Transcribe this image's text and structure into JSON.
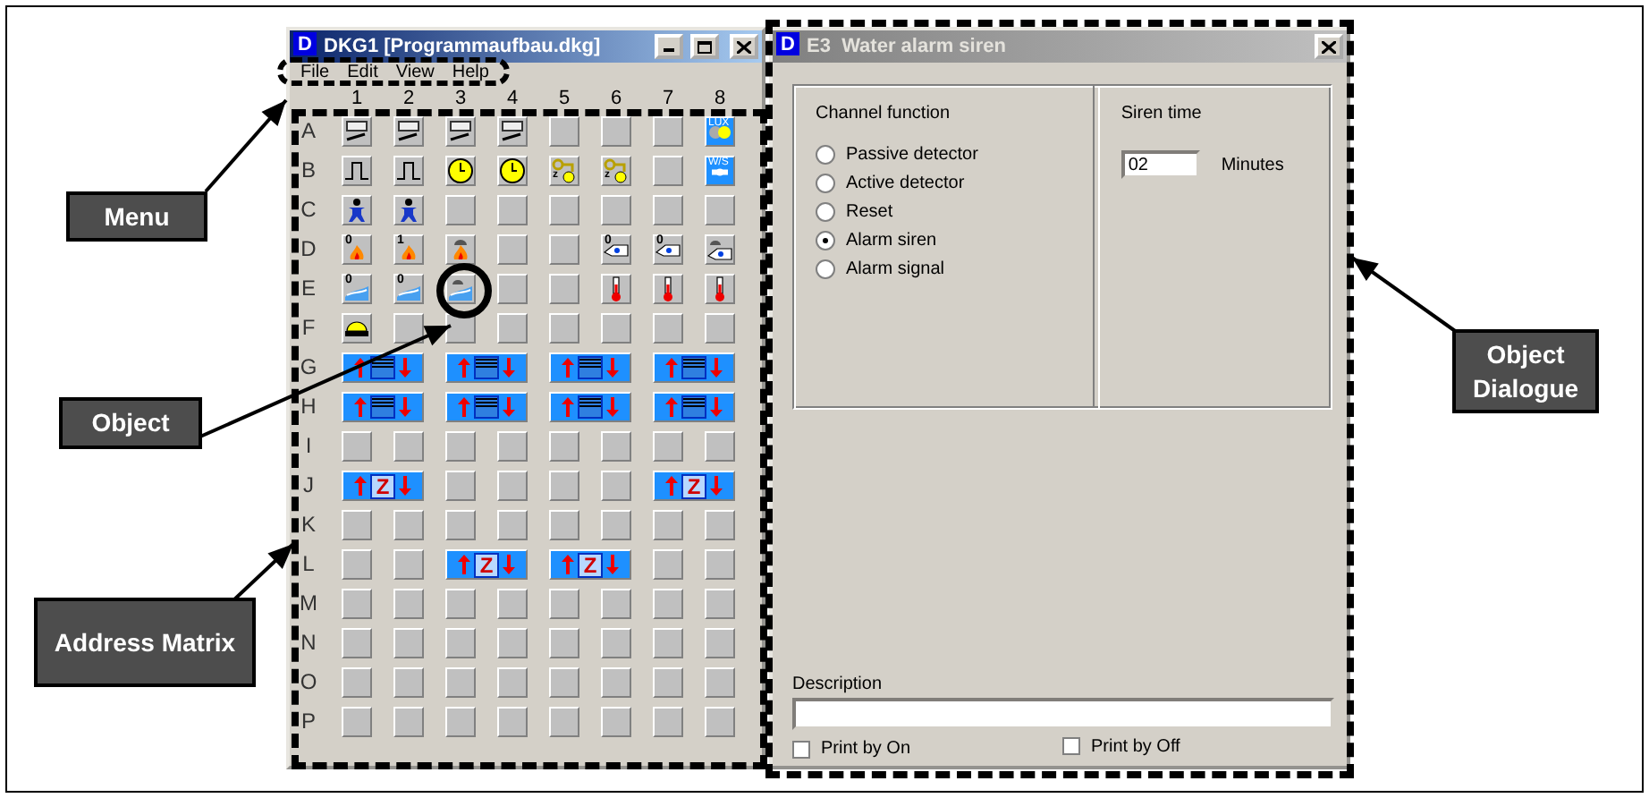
{
  "matrix_window": {
    "icon": "D",
    "title": "DKG1 [Programmaufbau.dkg]",
    "active": true,
    "menu": [
      "File",
      "Edit",
      "View",
      "Help"
    ],
    "columns": [
      "1",
      "2",
      "3",
      "4",
      "5",
      "6",
      "7",
      "8"
    ],
    "rows": [
      {
        "label": "A",
        "cells": [
          {
            "kind": "switch",
            "circled": false
          },
          {
            "kind": "switch",
            "circled": false
          },
          {
            "kind": "switch",
            "circled": false
          },
          {
            "kind": "switch",
            "circled": false
          },
          {
            "kind": "empty",
            "circled": false
          },
          {
            "kind": "empty",
            "circled": false
          },
          {
            "kind": "empty",
            "circled": false
          },
          {
            "kind": "lux",
            "label": "LUX",
            "circled": false
          }
        ]
      },
      {
        "label": "B",
        "cells": [
          {
            "kind": "pulse",
            "circled": false
          },
          {
            "kind": "pulse",
            "circled": false
          },
          {
            "kind": "clock",
            "circled": false
          },
          {
            "kind": "clock",
            "circled": false
          },
          {
            "kind": "key-timer",
            "label": "z",
            "circled": false
          },
          {
            "kind": "key-timer",
            "label": "z",
            "circled": false
          },
          {
            "kind": "empty",
            "circled": false
          },
          {
            "kind": "ws",
            "label": "W/S",
            "circled": false
          }
        ]
      },
      {
        "label": "C",
        "cells": [
          {
            "kind": "person",
            "circled": false
          },
          {
            "kind": "person",
            "circled": false
          },
          {
            "kind": "empty",
            "circled": false
          },
          {
            "kind": "empty",
            "circled": false
          },
          {
            "kind": "empty",
            "circled": false
          },
          {
            "kind": "empty",
            "circled": false
          },
          {
            "kind": "empty",
            "circled": false
          },
          {
            "kind": "empty",
            "circled": false
          }
        ]
      },
      {
        "label": "D",
        "cells": [
          {
            "kind": "fire",
            "tag": "0",
            "circled": false
          },
          {
            "kind": "fire",
            "tag": "1",
            "circled": false
          },
          {
            "kind": "fire-siren",
            "circled": false
          },
          {
            "kind": "empty",
            "circled": false
          },
          {
            "kind": "empty",
            "circled": false
          },
          {
            "kind": "hand",
            "tag": "0",
            "circled": false
          },
          {
            "kind": "hand",
            "tag": "0",
            "circled": false
          },
          {
            "kind": "hand-siren",
            "circled": false
          }
        ]
      },
      {
        "label": "E",
        "cells": [
          {
            "kind": "water",
            "tag": "0",
            "circled": false
          },
          {
            "kind": "water",
            "tag": "0",
            "circled": false
          },
          {
            "kind": "water-siren",
            "circled": true
          },
          {
            "kind": "empty",
            "circled": false
          },
          {
            "kind": "empty",
            "circled": false
          },
          {
            "kind": "thermometer",
            "circled": false
          },
          {
            "kind": "thermometer",
            "circled": false
          },
          {
            "kind": "thermometer",
            "circled": false
          }
        ]
      },
      {
        "label": "F",
        "cells": [
          {
            "kind": "bell",
            "circled": false
          },
          {
            "kind": "empty",
            "circled": false
          },
          {
            "kind": "empty",
            "circled": false
          },
          {
            "kind": "empty",
            "circled": false
          },
          {
            "kind": "empty",
            "circled": false
          },
          {
            "kind": "empty",
            "circled": false
          },
          {
            "kind": "empty",
            "circled": false
          },
          {
            "kind": "empty",
            "circled": false
          }
        ]
      },
      {
        "label": "G",
        "cells": [
          {
            "kind": "blind",
            "circled": false
          },
          {
            "kind": "blind",
            "circled": false
          },
          {
            "kind": "blind",
            "circled": false
          },
          {
            "kind": "blind",
            "circled": false
          }
        ]
      },
      {
        "label": "H",
        "cells": [
          {
            "kind": "blind",
            "circled": false
          },
          {
            "kind": "blind",
            "circled": false
          },
          {
            "kind": "blind",
            "circled": false
          },
          {
            "kind": "blind",
            "circled": false
          }
        ]
      },
      {
        "label": "I",
        "cells": [
          {
            "kind": "empty",
            "circled": false
          },
          {
            "kind": "empty",
            "circled": false
          },
          {
            "kind": "empty",
            "circled": false
          },
          {
            "kind": "empty",
            "circled": false
          },
          {
            "kind": "empty",
            "circled": false
          },
          {
            "kind": "empty",
            "circled": false
          },
          {
            "kind": "empty",
            "circled": false
          },
          {
            "kind": "empty",
            "circled": false
          }
        ]
      },
      {
        "label": "J",
        "cells": [
          {
            "kind": "z-block",
            "label": "Z",
            "circled": false
          },
          {
            "kind": "empty",
            "circled": false
          },
          {
            "kind": "empty",
            "circled": false
          },
          {
            "kind": "empty",
            "circled": false
          },
          {
            "kind": "empty",
            "circled": false
          },
          {
            "kind": "z-block",
            "label": "Z",
            "circled": false
          }
        ]
      },
      {
        "label": "K",
        "cells": [
          {
            "kind": "empty",
            "circled": false
          },
          {
            "kind": "empty",
            "circled": false
          },
          {
            "kind": "empty",
            "circled": false
          },
          {
            "kind": "empty",
            "circled": false
          },
          {
            "kind": "empty",
            "circled": false
          },
          {
            "kind": "empty",
            "circled": false
          },
          {
            "kind": "empty",
            "circled": false
          },
          {
            "kind": "empty",
            "circled": false
          }
        ]
      },
      {
        "label": "L",
        "cells": [
          {
            "kind": "empty",
            "circled": false
          },
          {
            "kind": "empty",
            "circled": false
          },
          {
            "kind": "z-block",
            "label": "Z",
            "circled": false
          },
          {
            "kind": "z-block",
            "label": "Z",
            "circled": false
          },
          {
            "kind": "empty",
            "circled": false
          },
          {
            "kind": "empty",
            "circled": false
          }
        ]
      },
      {
        "label": "M",
        "cells": [
          {
            "kind": "empty",
            "circled": false
          },
          {
            "kind": "empty",
            "circled": false
          },
          {
            "kind": "empty",
            "circled": false
          },
          {
            "kind": "empty",
            "circled": false
          },
          {
            "kind": "empty",
            "circled": false
          },
          {
            "kind": "empty",
            "circled": false
          },
          {
            "kind": "empty",
            "circled": false
          },
          {
            "kind": "empty",
            "circled": false
          }
        ]
      },
      {
        "label": "N",
        "cells": [
          {
            "kind": "empty",
            "circled": false
          },
          {
            "kind": "empty",
            "circled": false
          },
          {
            "kind": "empty",
            "circled": false
          },
          {
            "kind": "empty",
            "circled": false
          },
          {
            "kind": "empty",
            "circled": false
          },
          {
            "kind": "empty",
            "circled": false
          },
          {
            "kind": "empty",
            "circled": false
          },
          {
            "kind": "empty",
            "circled": false
          }
        ]
      },
      {
        "label": "O",
        "cells": [
          {
            "kind": "empty",
            "circled": false
          },
          {
            "kind": "empty",
            "circled": false
          },
          {
            "kind": "empty",
            "circled": false
          },
          {
            "kind": "empty",
            "circled": false
          },
          {
            "kind": "empty",
            "circled": false
          },
          {
            "kind": "empty",
            "circled": false
          },
          {
            "kind": "empty",
            "circled": false
          },
          {
            "kind": "empty",
            "circled": false
          }
        ]
      },
      {
        "label": "P",
        "cells": [
          {
            "kind": "empty",
            "circled": false
          },
          {
            "kind": "empty",
            "circled": false
          },
          {
            "kind": "empty",
            "circled": false
          },
          {
            "kind": "empty",
            "circled": false
          },
          {
            "kind": "empty",
            "circled": false
          },
          {
            "kind": "empty",
            "circled": false
          },
          {
            "kind": "empty",
            "circled": false
          },
          {
            "kind": "empty",
            "circled": false
          }
        ]
      }
    ]
  },
  "object_dialog": {
    "icon": "D",
    "title": "E3  Water alarm siren",
    "active": false,
    "channel_function": {
      "label": "Channel function",
      "options": [
        {
          "label": "Passive detector",
          "selected": false
        },
        {
          "label": "Active detector",
          "selected": false
        },
        {
          "label": "Reset",
          "selected": false
        },
        {
          "label": "Alarm siren",
          "selected": true
        },
        {
          "label": "Alarm signal",
          "selected": false
        }
      ]
    },
    "siren_time": {
      "label": "Siren time",
      "value": "02",
      "unit": "Minutes"
    },
    "description": {
      "label": "Description"
    },
    "checkboxes": [
      {
        "label": "Print by On",
        "checked": false
      },
      {
        "label": "Print by Off",
        "checked": false
      }
    ]
  },
  "callouts": [
    {
      "text": "Menu"
    },
    {
      "text": "Object"
    },
    {
      "text": "Address Matrix"
    },
    {
      "text": "Object Dialogue"
    }
  ]
}
